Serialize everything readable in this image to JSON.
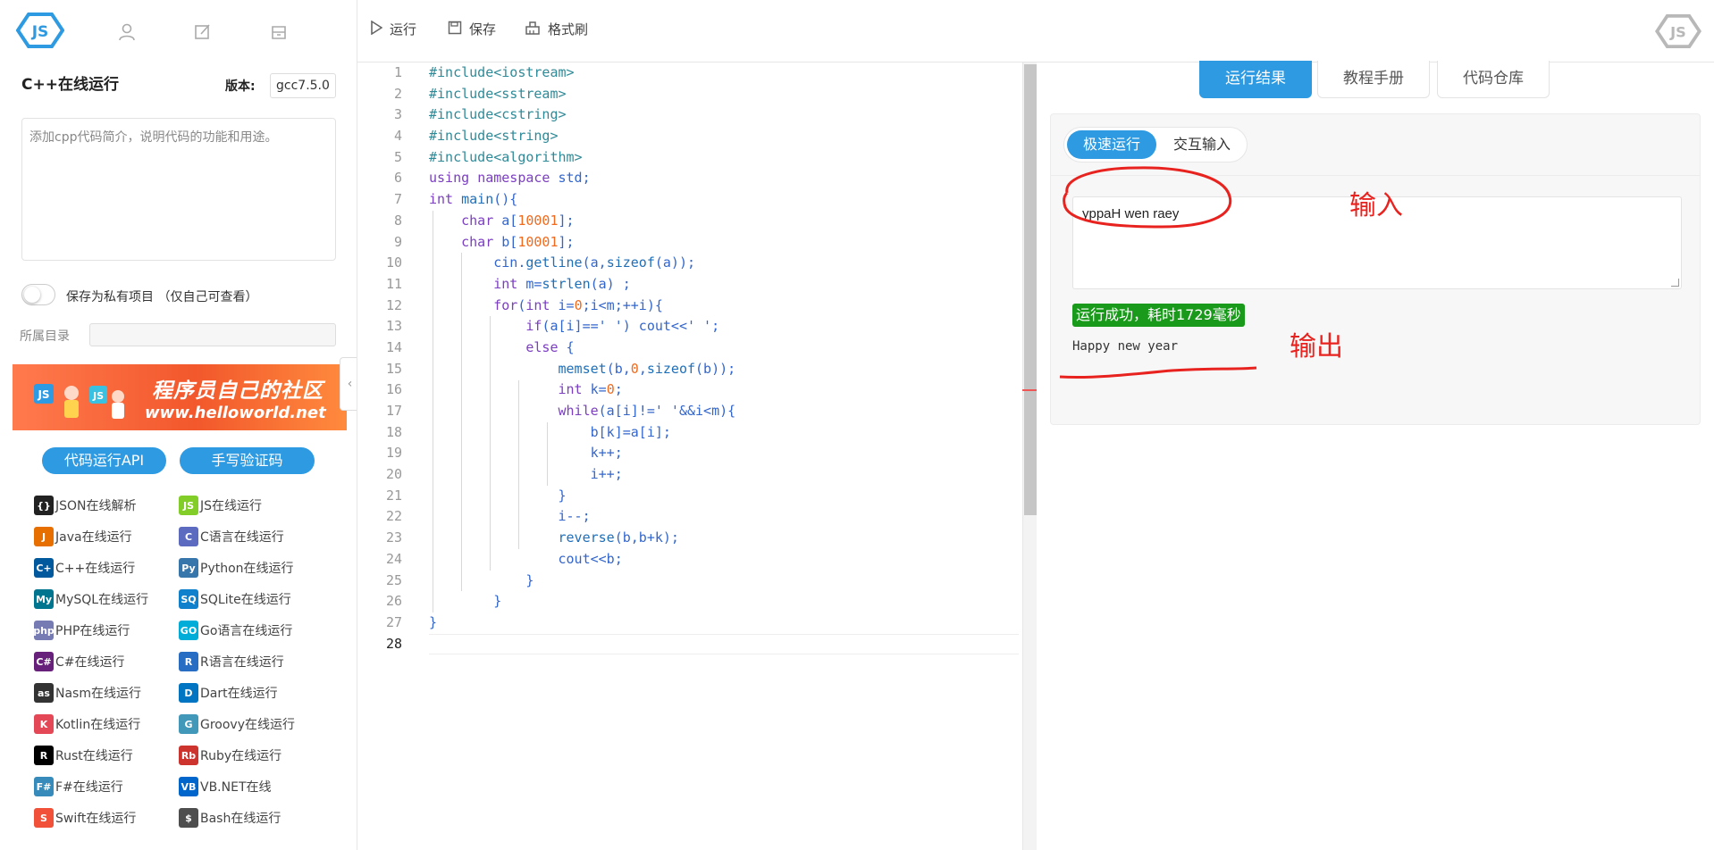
{
  "sidebar": {
    "project_title": "C++在线运行",
    "version_label": "版本:",
    "version_value": "gcc7.5.0",
    "description_placeholder": "添加cpp代码简介，说明代码的功能和用途。",
    "private_label": "保存为私有项目 （仅自己可查看）",
    "directory_label": "所属目录",
    "banner_title": "程序员自己的社区",
    "banner_url": "www.helloworld.net",
    "api_button": "代码运行API",
    "captcha_button": "手写验证码",
    "languages": [
      {
        "label": "JSON在线解析",
        "icon": "json-icon",
        "color": "#222222"
      },
      {
        "label": "JS在线运行",
        "icon": "nodejs-icon",
        "color": "#83cd29"
      },
      {
        "label": "Java在线运行",
        "icon": "java-icon",
        "color": "#e76f00"
      },
      {
        "label": "C语言在线运行",
        "icon": "c-icon",
        "color": "#5c6bc0"
      },
      {
        "label": "C++在线运行",
        "icon": "cpp-icon",
        "color": "#00599c"
      },
      {
        "label": "Python在线运行",
        "icon": "python-icon",
        "color": "#3776ab"
      },
      {
        "label": "MySQL在线运行",
        "icon": "mysql-icon",
        "color": "#00758f"
      },
      {
        "label": "SQLite在线运行",
        "icon": "sqlite-icon",
        "color": "#0f80cc"
      },
      {
        "label": "PHP在线运行",
        "icon": "php-icon",
        "color": "#777bb4"
      },
      {
        "label": "Go语言在线运行",
        "icon": "go-icon",
        "color": "#00add8"
      },
      {
        "label": "C#在线运行",
        "icon": "csharp-icon",
        "color": "#68217a"
      },
      {
        "label": "R语言在线运行",
        "icon": "r-icon",
        "color": "#276dc3"
      },
      {
        "label": "Nasm在线运行",
        "icon": "nasm-icon",
        "color": "#333333"
      },
      {
        "label": "Dart在线运行",
        "icon": "dart-icon",
        "color": "#0175c2"
      },
      {
        "label": "Kotlin在线运行",
        "icon": "kotlin-icon",
        "color": "#e44857"
      },
      {
        "label": "Groovy在线运行",
        "icon": "groovy-icon",
        "color": "#4298b8"
      },
      {
        "label": "Rust在线运行",
        "icon": "rust-icon",
        "color": "#000000"
      },
      {
        "label": "Ruby在线运行",
        "icon": "ruby-icon",
        "color": "#cc342d"
      },
      {
        "label": "F#在线运行",
        "icon": "fsharp-icon",
        "color": "#378bba"
      },
      {
        "label": "VB.NET在线",
        "icon": "vbnet-icon",
        "color": "#0066cc"
      },
      {
        "label": "Swift在线运行",
        "icon": "swift-icon",
        "color": "#f05138"
      },
      {
        "label": "Bash在线运行",
        "icon": "bash-icon",
        "color": "#4e4e4e"
      }
    ]
  },
  "toolbar": {
    "run_label": "运行",
    "save_label": "保存",
    "format_label": "格式刷"
  },
  "editor": {
    "active_line": 28,
    "lines": [
      "#include<iostream>",
      "#include<sstream>",
      "#include<cstring>",
      "#include<string>",
      "#include<algorithm>",
      "using namespace std;",
      "int main(){",
      "    char a[10001];",
      "    char b[10001];",
      "        cin.getline(a,sizeof(a));",
      "        int m=strlen(a) ;",
      "        for(int i=0;i<m;++i){",
      "            if(a[i]==' ') cout<<' ';",
      "            else {",
      "                memset(b,0,sizeof(b));",
      "                int k=0;",
      "                while(a[i]!=' '&&i<m){",
      "                    b[k]=a[i];",
      "                    k++;",
      "                    i++;",
      "                }",
      "                i--;",
      "                reverse(b,b+k);",
      "                cout<<b;",
      "            }",
      "        }",
      "}",
      ""
    ]
  },
  "result": {
    "tabs": [
      "运行结果",
      "教程手册",
      "代码仓库"
    ],
    "modes": [
      "极速运行",
      "交互输入"
    ],
    "stdin": "yppaH wen raey",
    "status": "运行成功，耗时1729毫秒",
    "stdout": "Happy new year",
    "annotation_input": "输入",
    "annotation_output": "输出",
    "annotation_color": "#e8231f",
    "accent_color": "#2d9ae2",
    "success_color": "#1a9a1a"
  }
}
